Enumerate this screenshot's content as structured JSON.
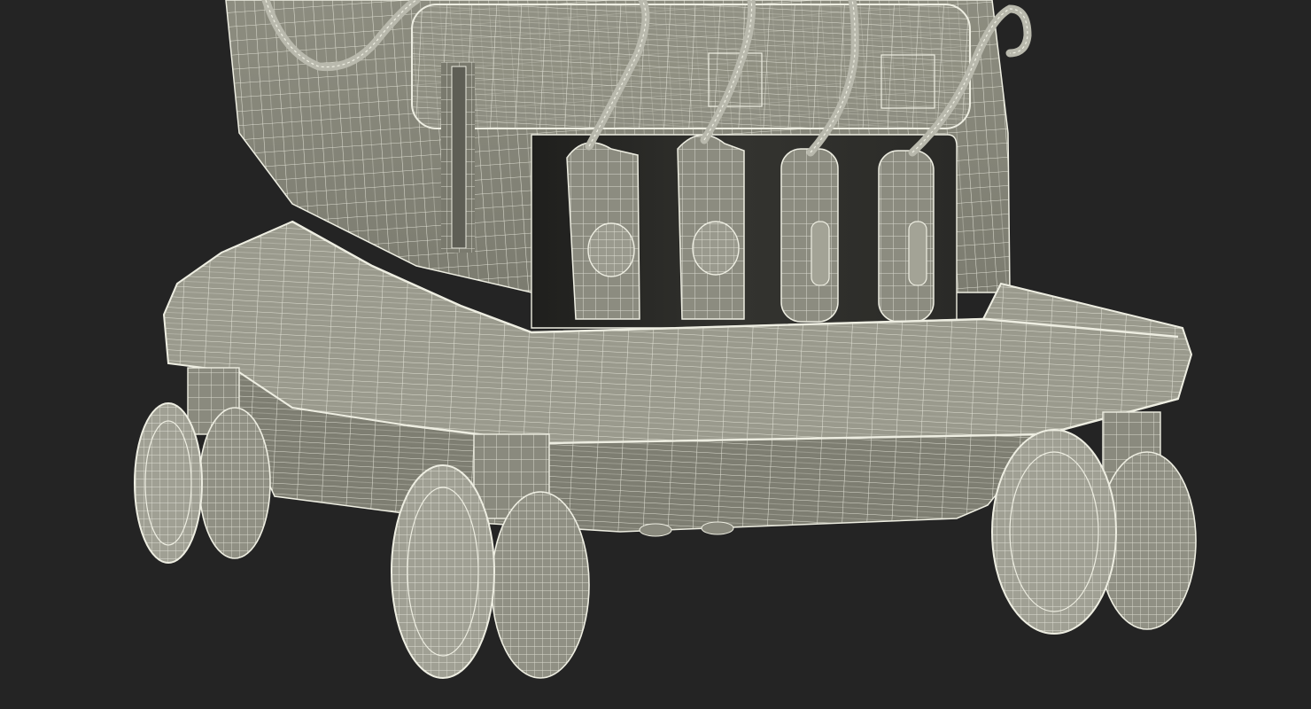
{
  "scene": {
    "subject": "ultrasound-cart-wireframe-render",
    "colors": {
      "background": "#242424",
      "surface": "#8a8a7c",
      "surface_light": "#a3a396",
      "surface_dark": "#6e6e62",
      "cavity": "#2a2a27",
      "wire": "#eeeee2"
    }
  }
}
